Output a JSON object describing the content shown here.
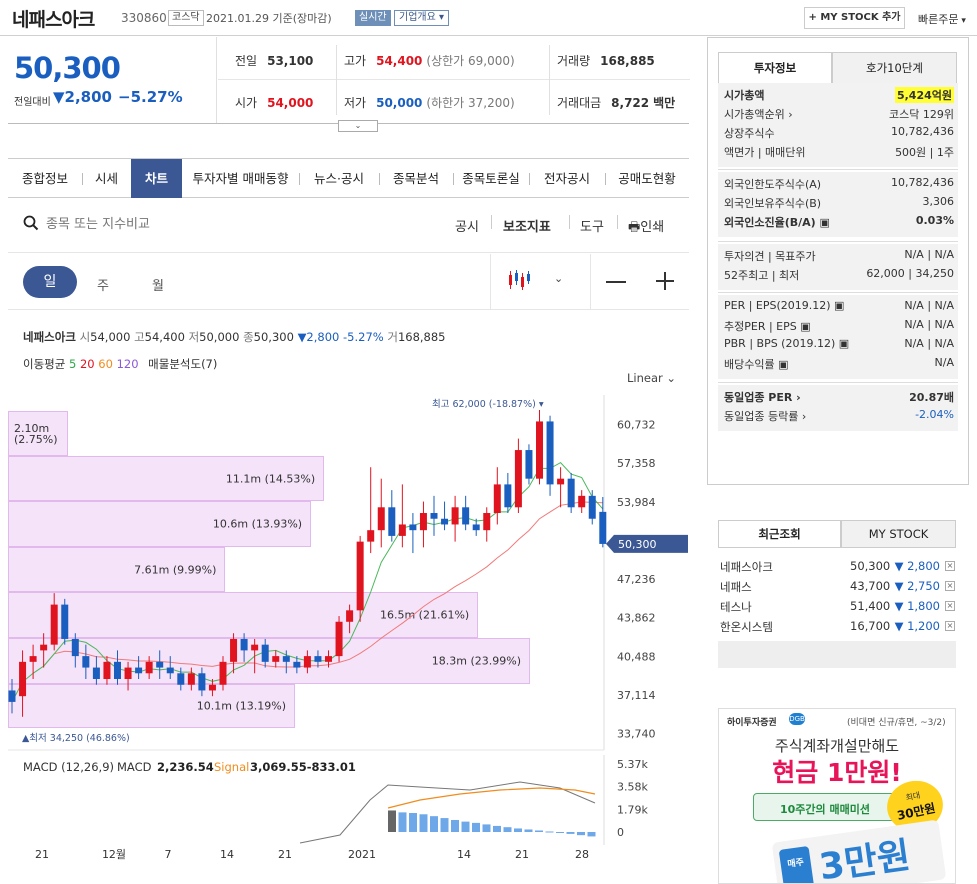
{
  "header": {
    "name": "네패스아크",
    "code": "330860",
    "market": "코스닥",
    "date": "2021.01.29 기준(장마감)",
    "live": "실시간",
    "corp": "기업개요",
    "mystock": "+ MY STOCK 추가",
    "quick": "빠른주문"
  },
  "price": {
    "current": "50,300",
    "change_label": "전일대비",
    "change": "▼2,800",
    "change_pct": "−5.27%"
  },
  "quote": [
    {
      "label": "전일",
      "value": "53,100",
      "cls": "",
      "extra": ""
    },
    {
      "label": "고가",
      "value": "54,400",
      "cls": "red",
      "extra": "(상한가 69,000)"
    },
    {
      "label": "거래량",
      "value": "168,885",
      "cls": "",
      "extra": ""
    },
    {
      "label": "시가",
      "value": "54,000",
      "cls": "red",
      "extra": ""
    },
    {
      "label": "저가",
      "value": "50,000",
      "cls": "blue",
      "extra": "(하한가 37,200)"
    },
    {
      "label": "거래대금",
      "value": "8,722",
      "cls": "",
      "extra": "백만"
    }
  ],
  "tabs": [
    "종합정보",
    "시세",
    "차트",
    "투자자별 매매동향",
    "뉴스·공시",
    "종목분석",
    "종목토론실",
    "전자공시",
    "공매도현황"
  ],
  "search": {
    "placeholder": "종목 또는 지수비교"
  },
  "tools": [
    "공시",
    "보조지표",
    "도구",
    "인쇄"
  ],
  "periods": [
    "일",
    "주",
    "월"
  ],
  "ohlc": {
    "name": "네패스아크",
    "open_l": "시",
    "open": "54,000",
    "high_l": "고",
    "high": "54,400",
    "low_l": "저",
    "low": "50,000",
    "close_l": "종",
    "close": "50,300",
    "chg": "▼2,800",
    "pct": "-5.27%",
    "vol_l": "거",
    "vol": "168,885"
  },
  "ma": {
    "label": "이동평균",
    "p5": "5",
    "p20": "20",
    "p60": "60",
    "p120": "120",
    "profile": "매물분석도(7)"
  },
  "scale": "Linear",
  "chart_data": {
    "type": "candlestick",
    "price_ticks": [
      "60,732",
      "57,358",
      "53,984",
      "50,300",
      "47,236",
      "43,862",
      "40,488",
      "37,114",
      "33,740"
    ],
    "current": "50,300",
    "max_label": "최고 62,000 (-18.87%)",
    "min_label": "▲최저 34,250 (46.86%)",
    "volume_profile": [
      "2.10m (2.75%)",
      "11.1m (14.53%)",
      "10.6m (13.93%)",
      "7.61m (9.99%)",
      "16.5m (21.61%)",
      "18.3m (23.99%)",
      "10.1m (13.19%)"
    ],
    "volume_profile_share": [
      2.75,
      14.53,
      13.93,
      9.99,
      21.61,
      23.99,
      13.19
    ],
    "candles": [
      [
        37500,
        38500,
        35500,
        36500
      ],
      [
        37000,
        41000,
        35200,
        40000
      ],
      [
        40000,
        41500,
        38500,
        40500
      ],
      [
        41000,
        42500,
        39500,
        41500
      ],
      [
        41500,
        46000,
        41000,
        45000
      ],
      [
        45000,
        45500,
        41500,
        42000
      ],
      [
        42000,
        42500,
        39500,
        40500
      ],
      [
        40500,
        41500,
        38500,
        39500
      ],
      [
        39500,
        40500,
        38000,
        38500
      ],
      [
        38500,
        40500,
        38000,
        40000
      ],
      [
        40000,
        41000,
        38000,
        38500
      ],
      [
        38500,
        40000,
        37500,
        39500
      ],
      [
        39500,
        40500,
        38500,
        39000
      ],
      [
        39000,
        40500,
        38500,
        40000
      ],
      [
        40000,
        41000,
        38500,
        39500
      ],
      [
        39500,
        40500,
        38500,
        39000
      ],
      [
        39000,
        39500,
        37500,
        38000
      ],
      [
        38000,
        39500,
        37500,
        39000
      ],
      [
        39000,
        39500,
        37000,
        37500
      ],
      [
        37500,
        38500,
        37000,
        38000
      ],
      [
        38000,
        40500,
        37500,
        40000
      ],
      [
        40000,
        42500,
        39000,
        42000
      ],
      [
        42000,
        42500,
        40000,
        41000
      ],
      [
        41000,
        42000,
        39000,
        41500
      ],
      [
        41500,
        42000,
        39500,
        40000
      ],
      [
        40000,
        41000,
        39500,
        40500
      ],
      [
        40500,
        41000,
        39000,
        40000
      ],
      [
        40000,
        40500,
        39000,
        39500
      ],
      [
        39500,
        41000,
        39000,
        40500
      ],
      [
        40500,
        41000,
        39500,
        40000
      ],
      [
        40000,
        41000,
        39500,
        40500
      ],
      [
        40500,
        44000,
        40000,
        43500
      ],
      [
        43500,
        45000,
        42500,
        44500
      ],
      [
        44500,
        51000,
        43500,
        50500
      ],
      [
        50500,
        57000,
        49500,
        51500
      ],
      [
        51500,
        56000,
        50000,
        53500
      ],
      [
        53500,
        55000,
        50500,
        51000
      ],
      [
        51000,
        55500,
        50000,
        52000
      ],
      [
        52000,
        53000,
        49500,
        51500
      ],
      [
        51500,
        54000,
        50000,
        53000
      ],
      [
        53000,
        54500,
        51000,
        52500
      ],
      [
        52500,
        54000,
        51500,
        52000
      ],
      [
        52000,
        54500,
        50500,
        53500
      ],
      [
        53500,
        54500,
        51500,
        52000
      ],
      [
        52000,
        52500,
        51000,
        51500
      ],
      [
        51500,
        53500,
        50500,
        53000
      ],
      [
        53000,
        57000,
        52000,
        55500
      ],
      [
        55500,
        56500,
        53000,
        53500
      ],
      [
        53500,
        59500,
        53000,
        58500
      ],
      [
        58500,
        59000,
        55500,
        56000
      ],
      [
        56000,
        62000,
        55500,
        61000
      ],
      [
        61000,
        61500,
        54500,
        55500
      ],
      [
        55500,
        57000,
        53500,
        56000
      ],
      [
        56000,
        56500,
        53000,
        53500
      ],
      [
        53500,
        55000,
        53000,
        54500
      ],
      [
        54500,
        55000,
        52000,
        52500
      ],
      [
        53100,
        54400,
        50000,
        50300
      ]
    ],
    "macd": {
      "label": "MACD (12,26,9)",
      "name": "MACD",
      "value": "2,236.54",
      "signal_label": "Signal",
      "signal": "3,069.55-833.01",
      "ticks": [
        "5.37k",
        "3.58k",
        "1.79k",
        "0"
      ]
    },
    "x_labels": [
      "21",
      "12월",
      "7",
      "14",
      "21",
      "2021",
      "14",
      "21",
      "28"
    ]
  },
  "tabs_right": [
    "투자정보",
    "호가10단계"
  ],
  "invest": [
    [
      {
        "l": "시가총액",
        "v": "5,424억원",
        "b": true,
        "hl": true
      },
      {
        "l": "시가총액순위 ›",
        "v": "코스닥 129위"
      },
      {
        "l": "상장주식수",
        "v": "10,782,436"
      },
      {
        "l": "액면가 | 매매단위",
        "v": "500원 | 1주"
      }
    ],
    [
      {
        "l": "외국인한도주식수(A)",
        "v": "10,782,436"
      },
      {
        "l": "외국인보유주식수(B)",
        "v": "3,306"
      },
      {
        "l": "외국인소진율(B/A) ▣",
        "v": "0.03%",
        "b": true
      }
    ],
    [
      {
        "l": "투자의견 | 목표주가",
        "v": "N/A | N/A"
      },
      {
        "l": "52주최고 | 최저",
        "v": "62,000 | 34,250"
      }
    ],
    [
      {
        "l": "PER | EPS(2019.12) ▣",
        "v": "N/A | N/A"
      },
      {
        "l": "추정PER | EPS ▣",
        "v": "N/A | N/A"
      },
      {
        "l": "PBR | BPS (2019.12) ▣",
        "v": "N/A | N/A"
      },
      {
        "l": "배당수익률 ▣",
        "v": "N/A"
      }
    ],
    [
      {
        "l": "동일업종 PER ›",
        "v": "20.87배",
        "b": true
      },
      {
        "l": "동일업종 등락률 ›",
        "v": "-2.04%",
        "blue": true
      }
    ]
  ],
  "recent_tabs": [
    "최근조회",
    "MY STOCK"
  ],
  "recent": [
    {
      "name": "네패스아크",
      "price": "50,300",
      "chg": "▼ 2,800"
    },
    {
      "name": "네패스",
      "price": "43,700",
      "chg": "▼ 2,750"
    },
    {
      "name": "테스나",
      "price": "51,400",
      "chg": "▼ 1,800"
    },
    {
      "name": "한온시스템",
      "price": "16,700",
      "chg": "▼ 1,200"
    }
  ],
  "ad": {
    "brand": "하이투자증권",
    "note": "(비대면 신규/휴면, ~3/2)",
    "line1": "주식계좌개설만해도",
    "line2": "현금 1만원!",
    "badge1": "최대",
    "badge2": "30만원",
    "mission": "10주간의 매매미션",
    "big": "3만원",
    "side": "매주"
  }
}
